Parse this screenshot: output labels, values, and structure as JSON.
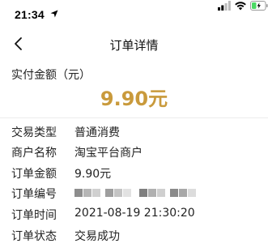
{
  "status_bar": {
    "time": "21:34"
  },
  "nav": {
    "title": "订单详情"
  },
  "summary": {
    "label": "实付金额（元）",
    "amount": "9.90元"
  },
  "details": [
    {
      "label": "交易类型",
      "value": "普通消费"
    },
    {
      "label": "商户名称",
      "value": "淘宝平台商户"
    },
    {
      "label": "订单金额",
      "value": "9.90元"
    },
    {
      "label": "订单编号",
      "value": ""
    },
    {
      "label": "订单时间",
      "value": "2021-08-19 21:30:20"
    },
    {
      "label": "订单状态",
      "value": "交易成功"
    }
  ],
  "colors": {
    "amount": "#c99a3c",
    "battery": "#4cd964"
  },
  "icons": [
    "location-arrow-icon",
    "signal-icon",
    "wifi-icon",
    "battery-icon",
    "back-chevron-icon"
  ]
}
